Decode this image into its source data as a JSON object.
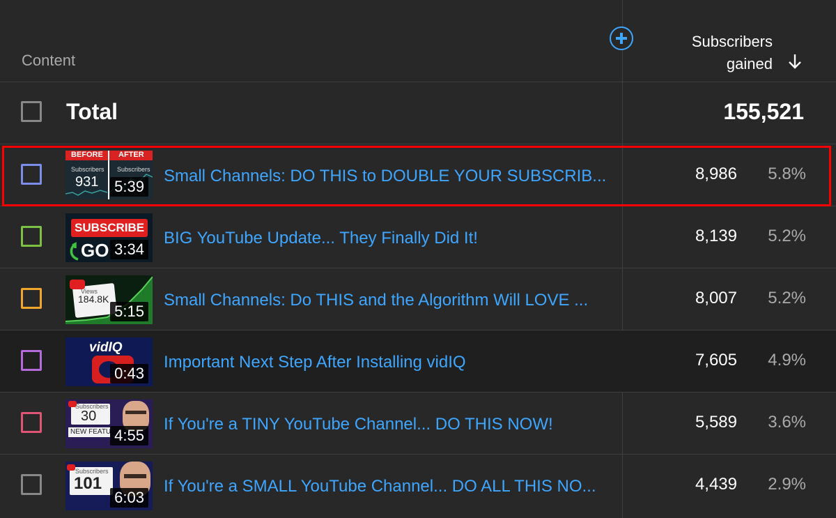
{
  "header": {
    "content_label": "Content",
    "metric_line1": "Subscribers",
    "metric_line2": "gained",
    "sort_icon": "arrow-down-icon",
    "add_icon": "plus-circle-icon"
  },
  "total": {
    "label": "Total",
    "value": "155,521"
  },
  "rows": [
    {
      "title": "Small Channels: DO THIS to DOUBLE YOUR SUBSCRIB...",
      "duration": "5:39",
      "value": "8,986",
      "pct": "5.8%",
      "color": "#7b8eea",
      "thumb": {
        "before": "BEFORE",
        "after": "AFTER",
        "sub_label": "Subscribers",
        "count": "931"
      }
    },
    {
      "title": "BIG YouTube Update... They Finally Did It!",
      "duration": "3:34",
      "value": "8,139",
      "pct": "5.2%",
      "color": "#7cc143",
      "thumb": {
        "banner": "SUBSCRIBE",
        "word": "GO"
      }
    },
    {
      "title": "Small Channels: Do THIS and the Algorithm Will LOVE ...",
      "duration": "5:15",
      "value": "8,007",
      "pct": "5.2%",
      "color": "#f0a52c",
      "thumb": {
        "views_label": "Views",
        "views": "184.8K"
      }
    },
    {
      "title": "Important Next Step After Installing vidIQ",
      "duration": "0:43",
      "value": "7,605",
      "pct": "4.9%",
      "color": "#b46ad9",
      "thumb": {
        "brand": "vidIQ"
      }
    },
    {
      "title": "If You're a TINY YouTube Channel... DO THIS NOW!",
      "duration": "4:55",
      "value": "5,589",
      "pct": "3.6%",
      "color": "#e05575",
      "thumb": {
        "sub_label": "Subscribers",
        "count": "30",
        "feature": "NEW FEATU"
      }
    },
    {
      "title": "If You're a SMALL YouTube Channel... DO ALL THIS NO...",
      "duration": "6:03",
      "value": "4,439",
      "pct": "2.9%",
      "color": "#888888",
      "thumb": {
        "sub_label": "Subscribers",
        "count": "101"
      }
    }
  ]
}
